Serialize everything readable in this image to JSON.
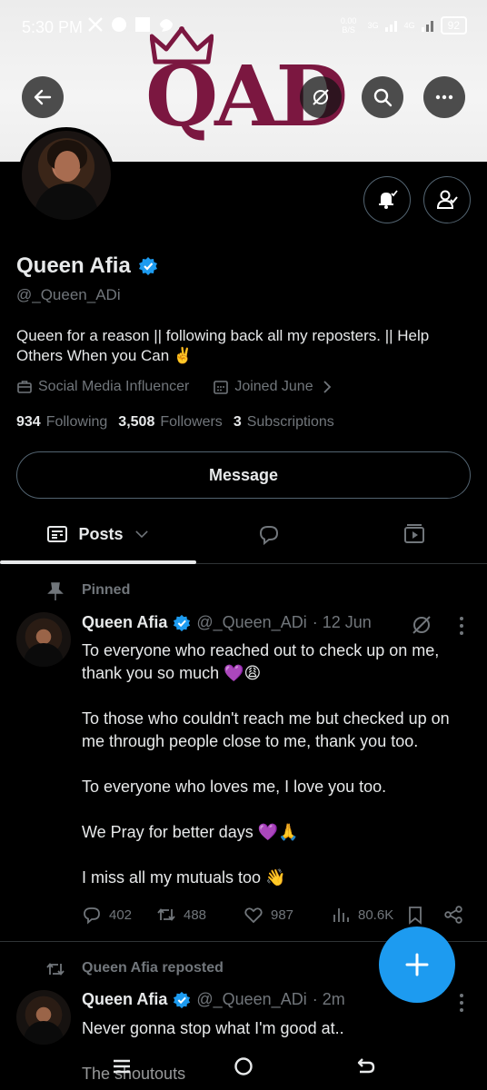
{
  "status_bar": {
    "time": "5:30 PM",
    "net_speed": "0.00 B/S",
    "net_3g": "3G",
    "net_4g": "4G",
    "battery": "92"
  },
  "banner": {
    "logo_text": "QAD"
  },
  "profile": {
    "name": "Queen Afia",
    "handle": "@_Queen_ADi",
    "bio": "Queen for a reason || following back all my reposters. || Help Others When you Can ✌️",
    "profession": "Social Media Influencer",
    "joined": "Joined June",
    "following_count": "934",
    "following_label": "Following",
    "followers_count": "3,508",
    "followers_label": "Followers",
    "subscriptions_count": "3",
    "subscriptions_label": "Subscriptions",
    "message_label": "Message"
  },
  "tabs": {
    "posts_label": "Posts"
  },
  "posts": [
    {
      "context": "Pinned",
      "author": "Queen Afia",
      "handle": "@_Queen_ADi",
      "time": "· 12 Jun",
      "paragraphs": [
        "To everyone who reached out to check up on me, thank you so much 💜😩",
        "To those who couldn't reach me but checked up on me through people close to me, thank you too.",
        "To everyone who loves me, I love you too.",
        "We Pray for better days 💜🙏",
        "I miss all my mutuals too 👋"
      ],
      "replies": "402",
      "reposts": "488",
      "likes": "987",
      "views": "80.6K"
    },
    {
      "context": "Queen Afia reposted",
      "author": "Queen Afia",
      "handle": "@_Queen_ADi",
      "time": "· 2m",
      "paragraphs": [
        "Never gonna stop what I'm good at..",
        "The shoutouts"
      ]
    }
  ],
  "colors": {
    "accent": "#1d9bf0",
    "background": "#000000",
    "text_primary": "#e7e9ea",
    "text_secondary": "#71767b",
    "logo": "#7b1740"
  }
}
